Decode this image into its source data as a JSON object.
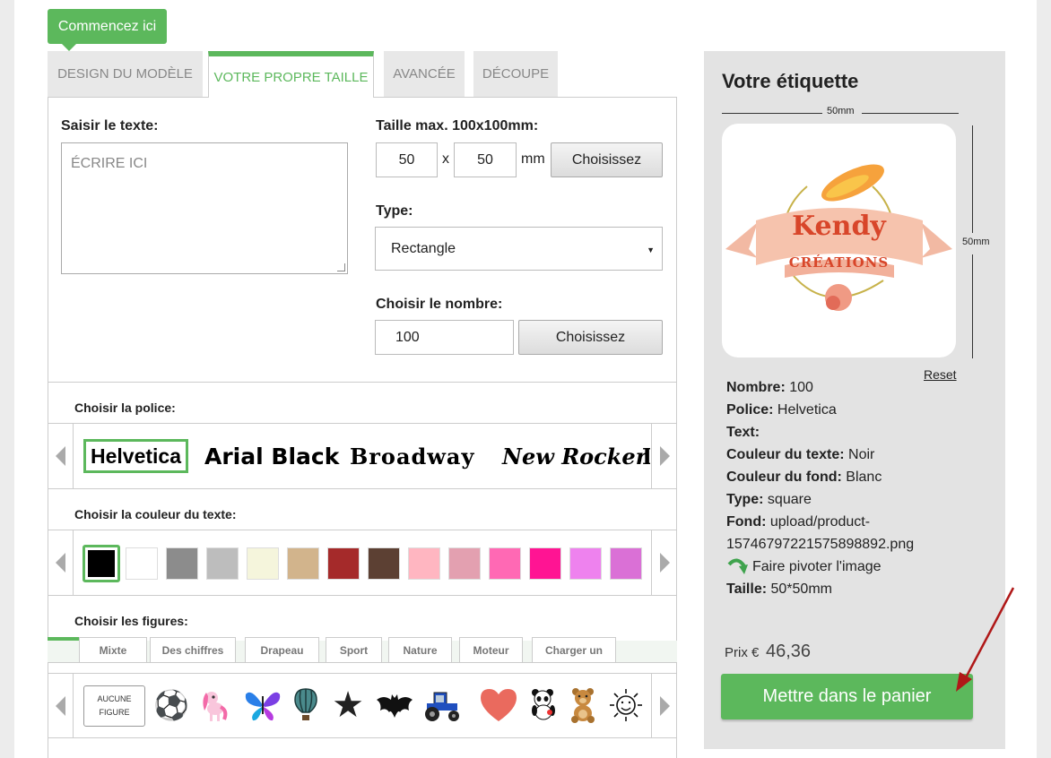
{
  "start_button": "Commencez ici",
  "tabs": [
    {
      "label": "DESIGN DU MODÈLE"
    },
    {
      "label": "VOTRE PROPRE TAILLE"
    },
    {
      "label": "AVANCÉE"
    },
    {
      "label": "DÉCOUPE"
    }
  ],
  "text_section": {
    "label": "Saisir le texte:",
    "placeholder": "ÉCRIRE ICI"
  },
  "size_section": {
    "label": "Taille max. 100x100mm:",
    "width": "50",
    "height": "50",
    "sep": "x",
    "unit": "mm",
    "button": "Choisissez"
  },
  "type_section": {
    "label": "Type:",
    "selected": "Rectangle"
  },
  "quantity_section": {
    "label": "Choisir le nombre:",
    "value": "100",
    "button": "Choisissez"
  },
  "font_section": {
    "label": "Choisir la police:",
    "fonts": [
      "Helvetica",
      "Arial Black",
      "Broadway",
      "New Rocker",
      "I"
    ]
  },
  "color_section": {
    "label": "Choisir la couleur du texte:",
    "colors": [
      "#000000",
      "#ffffff",
      "#8c8c8c",
      "#bdbdbd",
      "#f5f5dc",
      "#d2b48c",
      "#a52a2a",
      "#5c4033",
      "#ffb6c1",
      "#e3a0b0",
      "#ff69b4",
      "#ff1493",
      "#ee82ee",
      "#da70d6",
      "#ff00ff"
    ]
  },
  "figures_section": {
    "label": "Choisir les figures:",
    "tabs": [
      "Mixte",
      "Des chiffres",
      "Drapeau",
      "Sport",
      "Nature",
      "Moteur",
      "Charger un"
    ],
    "no_figure": "AUCUNE FIGURE",
    "icons": [
      "soccer-ball-icon",
      "pony-icon",
      "butterfly-icon",
      "hot-air-balloon-icon",
      "star-icon",
      "bat-icon",
      "tractor-icon",
      "heart-icon",
      "panda-icon",
      "teddy-bear-icon",
      "sun-icon"
    ]
  },
  "sidebar": {
    "title": "Votre étiquette",
    "width_dim": "50mm",
    "height_dim": "50mm",
    "logo": {
      "line1": "Kendy",
      "line2": "CRÉATIONS"
    },
    "reset": "Reset",
    "details": [
      {
        "key": "Nombre:",
        "value": " 100"
      },
      {
        "key": "Police:",
        "value": " Helvetica"
      },
      {
        "key": "Text:",
        "value": ""
      },
      {
        "key": "Couleur du texte:",
        "value": " Noir"
      },
      {
        "key": "Couleur du fond:",
        "value": " Blanc"
      },
      {
        "key": "Type:",
        "value": " square"
      },
      {
        "key": "Fond:",
        "value": " upload/product-"
      }
    ],
    "file_cont": "15746797221575898892.png",
    "rotate": "Faire pivoter l'image",
    "size_key": "Taille:",
    "size_value": " 50*50mm",
    "price_label": "Prix €",
    "price_value": "46,36",
    "cart_button": "Mettre dans le panier"
  }
}
